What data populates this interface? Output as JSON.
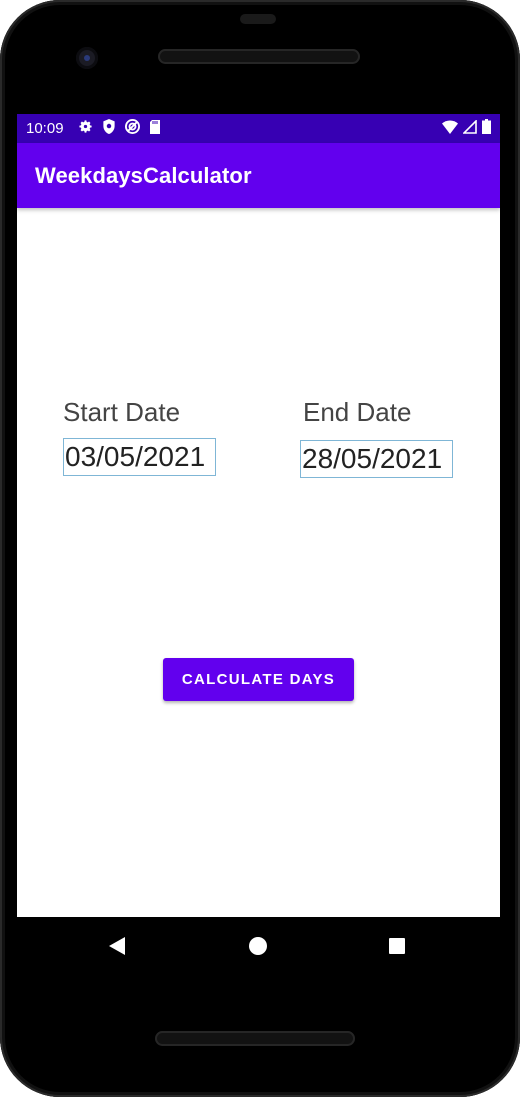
{
  "status_bar": {
    "time": "10:09",
    "left_icons": [
      "gear-icon",
      "shield-icon",
      "vpn-icon",
      "sd-card-icon"
    ],
    "right_icons": [
      "wifi-icon",
      "signal-icon",
      "battery-icon"
    ]
  },
  "app_bar": {
    "title": "WeekdaysCalculator",
    "color": "#6200ee",
    "status_color": "#3700b3"
  },
  "form": {
    "start_label": "Start Date",
    "start_value": "03/05/2021",
    "end_label": "End Date",
    "end_value": "28/05/2021"
  },
  "actions": {
    "calculate_label": "CALCULATE DAYS"
  },
  "navigation": {
    "icons": [
      "back-icon",
      "home-icon",
      "recents-icon"
    ]
  }
}
